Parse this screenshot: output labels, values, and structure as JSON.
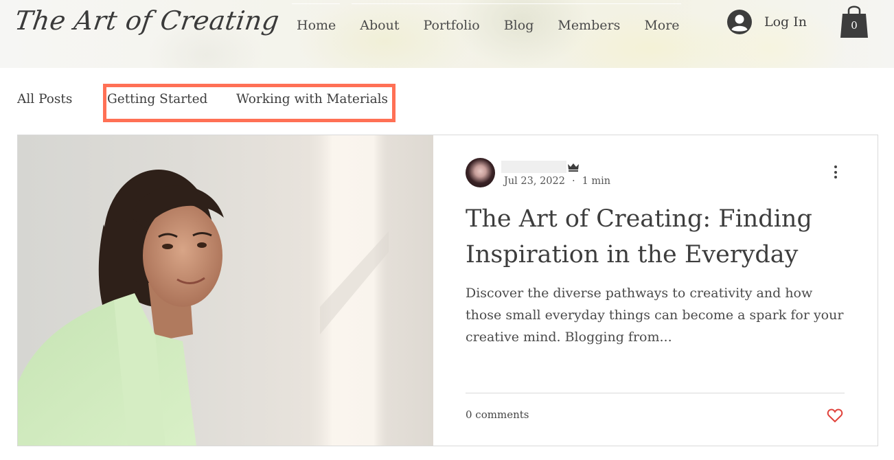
{
  "header": {
    "logo": "The Art of Creating",
    "nav": [
      {
        "label": "Home"
      },
      {
        "label": "About"
      },
      {
        "label": "Portfolio"
      },
      {
        "label": "Blog"
      },
      {
        "label": "Members"
      },
      {
        "label": "More"
      }
    ],
    "login_label": "Log In",
    "login_icon": "user-avatar-icon",
    "cart_icon": "shopping-bag-icon",
    "cart_count": "0"
  },
  "categories": {
    "items": [
      {
        "label": "All Posts"
      },
      {
        "label": "Getting Started"
      },
      {
        "label": "Working with Materials"
      }
    ],
    "highlight_color": "#ff7055"
  },
  "post": {
    "author_name": "",
    "author_badge_icon": "crown-icon",
    "date": "Jul 23, 2022",
    "separator": "·",
    "read_time": "1 min",
    "menu_icon": "more-vertical-icon",
    "title": "The Art of Creating: Finding Inspiration in the Everyday",
    "excerpt": "Discover the diverse pathways to creativity and how those small everyday things can become a spark for your creative mind. Blogging from...",
    "comments": "0 comments",
    "like_icon": "heart-icon",
    "like_color": "#e0413a",
    "image_alt": "Smiling woman in light green shirt against a sunlit wall"
  }
}
